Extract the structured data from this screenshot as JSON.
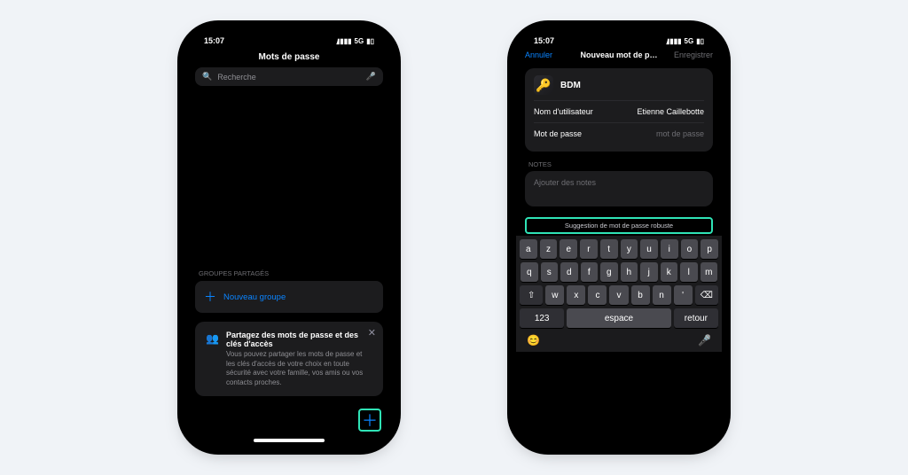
{
  "status": {
    "time": "15:07",
    "signal": "▮▮▮▮",
    "network": "5G",
    "battery": "84"
  },
  "screen1": {
    "title": "Mots de passe",
    "search_placeholder": "Recherche",
    "groups_label": "GROUPES PARTAGÉS",
    "new_group": "Nouveau groupe",
    "share_title": "Partagez des mots de passe et des clés d'accès",
    "share_sub": "Vous pouvez partager les mots de passe et les clés d'accès de votre choix en toute sécurité avec votre famille, vos amis ou vos contacts proches."
  },
  "screen2": {
    "cancel": "Annuler",
    "title": "Nouveau mot de p…",
    "save": "Enregistrer",
    "entry_name": "BDM",
    "username_label": "Nom d'utilisateur",
    "username_value": "Etienne Caillebotte",
    "password_label": "Mot de passe",
    "password_placeholder": "mot de passe",
    "notes_label": "NOTES",
    "notes_placeholder": "Ajouter des notes",
    "suggestion": "Suggestion de mot de passe robuste"
  },
  "keyboard": {
    "row1": [
      "a",
      "z",
      "e",
      "r",
      "t",
      "y",
      "u",
      "i",
      "o",
      "p"
    ],
    "row2": [
      "q",
      "s",
      "d",
      "f",
      "g",
      "h",
      "j",
      "k",
      "l",
      "m"
    ],
    "row3": [
      "⇧",
      "w",
      "x",
      "c",
      "v",
      "b",
      "n",
      "'",
      "⌫"
    ],
    "num": "123",
    "space": "espace",
    "return": "retour"
  }
}
